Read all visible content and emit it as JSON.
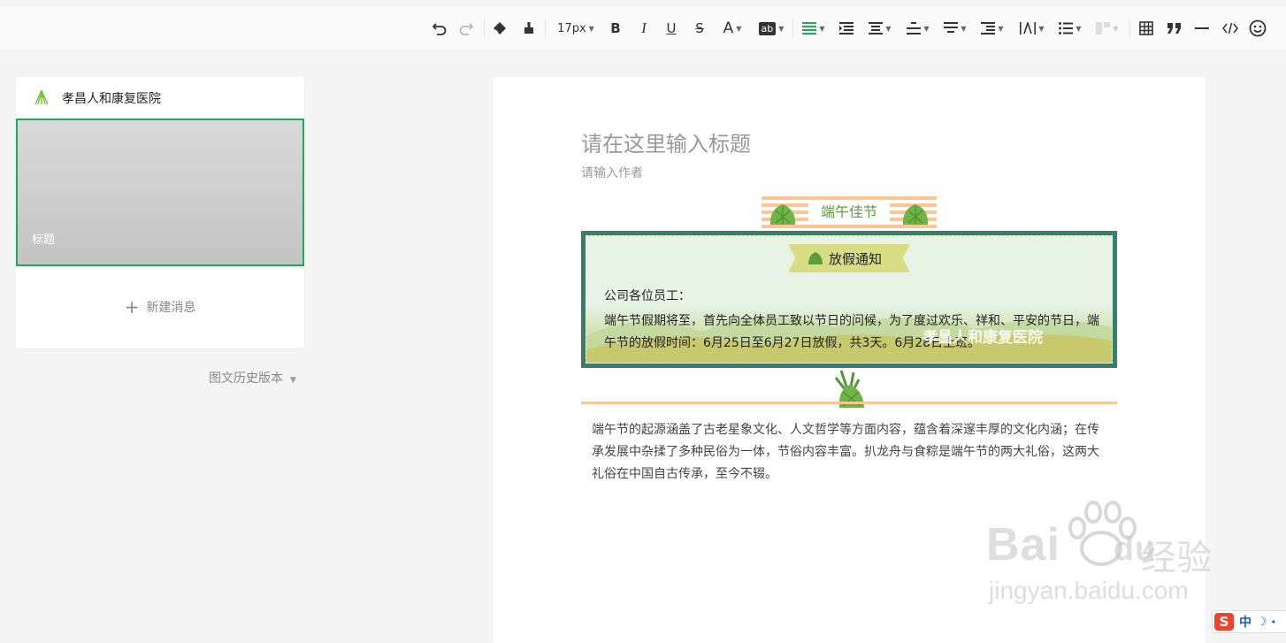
{
  "toolbar": {
    "font_size": "17px",
    "format_brush_label": "",
    "bold": "B",
    "italic": "I",
    "underline": "U",
    "strike": "S",
    "font_color": "A",
    "highlight": "ab"
  },
  "sidebar": {
    "account_name": "孝昌人和康复医院",
    "thumb_title": "标题",
    "new_message": "新建消息",
    "history": "图文历史版本"
  },
  "editor": {
    "title_placeholder": "请在这里输入标题",
    "author_placeholder": "请输入作者",
    "banner_label": "端午佳节",
    "notice_tag": "放假通知",
    "notice_greeting": "公司各位员工：",
    "notice_body": "端午节假期将至，首先向全体员工致以节日的问候，为了度过欢乐、祥和、平安的节日，端午节的放假时间：6月25日至6月27日放假，共3天。6月28日上班。",
    "notice_watermark": "孝昌人和康复医院",
    "paragraph": "端午节的起源涵盖了古老星象文化、人文哲学等方面内容，蕴含着深邃丰厚的文化内涵；在传承发展中杂揉了多种民俗为一体，节俗内容丰富。扒龙舟与食粽是端午节的两大礼俗，这两大礼俗在中国自古传承，至今不辍。"
  },
  "watermark": {
    "brand": "Bai",
    "brand_du": "du",
    "brand_cn": "经验",
    "url": "jingyan.baidu.com"
  },
  "ime": {
    "logo": "S",
    "mode": "中"
  },
  "colors": {
    "accent": "#1aad5a",
    "notice_border": "#377f6c",
    "banner_stripe": "#fcc594"
  }
}
